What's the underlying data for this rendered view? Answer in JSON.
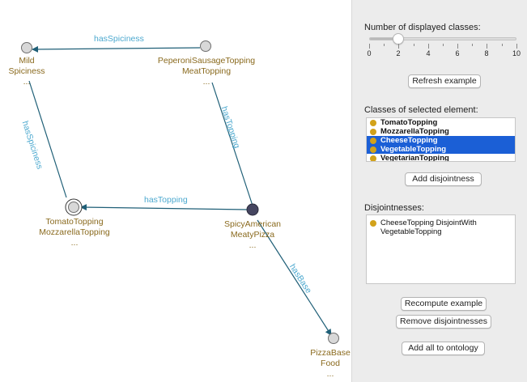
{
  "graph": {
    "nodes": [
      {
        "id": "mild",
        "lines": [
          "Mild",
          "Spiciness",
          "..."
        ]
      },
      {
        "id": "peperoni",
        "lines": [
          "PeperoniSausageTopping",
          "MeatTopping",
          "..."
        ]
      },
      {
        "id": "tomato",
        "lines": [
          "TomatoTopping",
          "MozzarellaTopping",
          "..."
        ]
      },
      {
        "id": "spicy",
        "lines": [
          "SpicyAmerican",
          "MeatyPizza",
          "..."
        ]
      },
      {
        "id": "base",
        "lines": [
          "PizzaBase",
          "Food",
          "..."
        ]
      }
    ],
    "edges": {
      "has_spiciness_top": "hasSpiciness",
      "has_spiciness_left": "hasSpiciness",
      "has_topping_right": "hasTopping",
      "has_topping_middle": "hasTopping",
      "has_base": "hasBase"
    },
    "colors": {
      "edge": "#1f5f77",
      "node_fill": "#d8d8d8",
      "selected_node_fill": "#454560",
      "node_text": "#8a6a1e",
      "edge_text": "#4da9cf"
    }
  },
  "panel": {
    "classes_count_label": "Number of displayed classes:",
    "slider": {
      "min": 0,
      "max": 10,
      "value": 2,
      "tick_labels": [
        "0",
        "2",
        "4",
        "6",
        "8",
        "10"
      ]
    },
    "refresh_button": "Refresh example",
    "classes_label": "Classes of selected element:",
    "classes": [
      {
        "label": "TomatoTopping",
        "selected": false
      },
      {
        "label": "MozzarellaTopping",
        "selected": false
      },
      {
        "label": "CheeseTopping",
        "selected": true
      },
      {
        "label": "VegetableTopping",
        "selected": true
      },
      {
        "label": "VegetarianTopping",
        "selected": false
      }
    ],
    "add_disjointness_button": "Add disjointness",
    "disjointnesses_label": "Disjointnesses:",
    "disjointnesses": [
      "CheeseTopping DisjointWith VegetableTopping"
    ],
    "recompute_button": "Recompute example",
    "remove_button": "Remove disjointnesses",
    "add_all_button": "Add all to ontology",
    "accent_color": "#1b5fd6",
    "bullet_color": "#d2a21a"
  }
}
